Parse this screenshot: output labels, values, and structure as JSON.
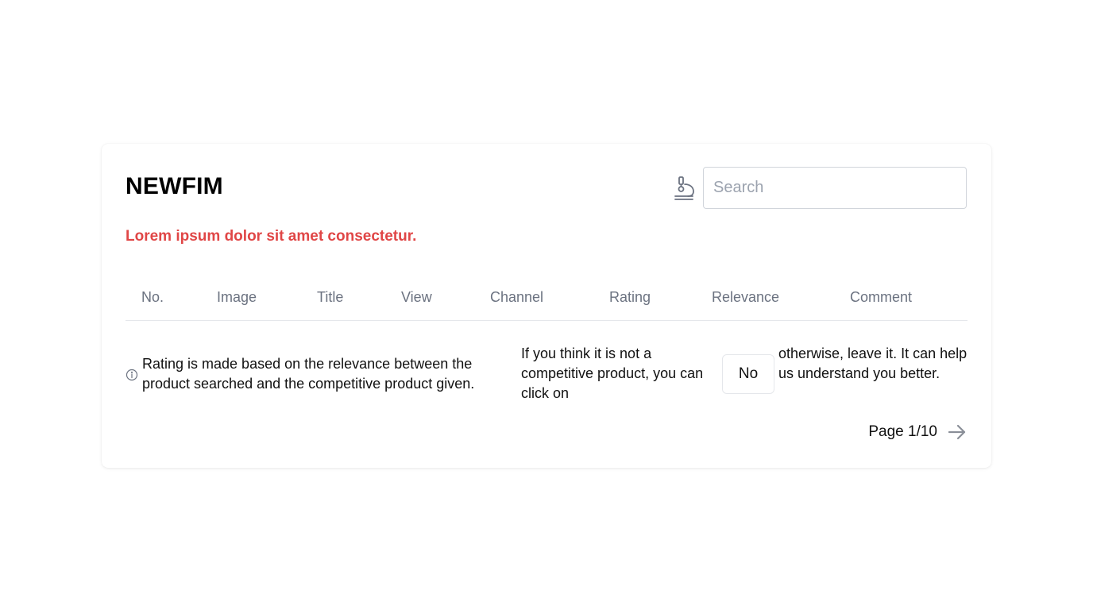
{
  "header": {
    "title": "NEWFIM",
    "lab_icon": "microscope-icon",
    "search_placeholder": "Search",
    "search_value": ""
  },
  "subtitle": "Lorem ipsum dolor sit amet consectetur.",
  "table": {
    "columns": [
      "No.",
      "Image",
      "Title",
      "View",
      "Channel",
      "Rating",
      "Relevance",
      "Comment"
    ]
  },
  "info": {
    "icon": "info-circle-icon",
    "text": "Rating is made based on the relevance between the product searched and the competitive product given.",
    "hint_before": "If you think it is not a competitive product, you can click on",
    "no_label": "No",
    "hint_after": "otherwise, leave it. It can help us understand you better."
  },
  "pagination": {
    "label": "Page 1/10",
    "next_icon": "arrow-right-icon"
  },
  "colors": {
    "accent_red": "#e04646",
    "header_gray": "#6b7280",
    "border": "#e5e7eb"
  }
}
